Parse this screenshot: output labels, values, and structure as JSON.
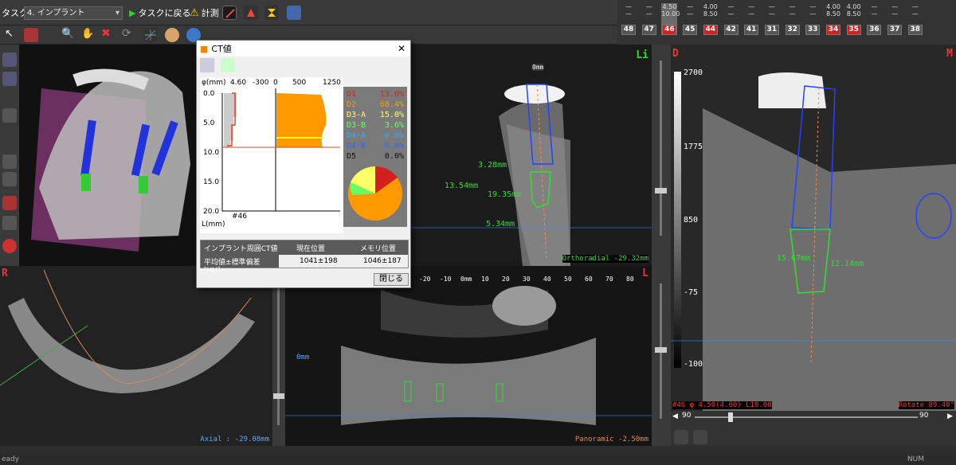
{
  "toolbar": {
    "task_label": "タスク",
    "task_value": "4. インプラント",
    "back_label": "タスクに戻る",
    "measure_label": "計測"
  },
  "teeth": {
    "upper": [
      {
        "l1": "",
        "l2": "",
        "num": "48"
      },
      {
        "l1": "",
        "l2": "",
        "num": "47"
      },
      {
        "l1": "4.50",
        "l2": "10.00",
        "num": "46",
        "sel": true
      },
      {
        "l1": "",
        "l2": "",
        "num": "45"
      },
      {
        "l1": "4.00",
        "l2": "8.50",
        "num": "44",
        "red": true
      },
      {
        "l1": "",
        "l2": "",
        "num": "42"
      },
      {
        "l1": "",
        "l2": "",
        "num": "41"
      },
      {
        "l1": "",
        "l2": "",
        "num": "31"
      },
      {
        "l1": "",
        "l2": "",
        "num": "32"
      },
      {
        "l1": "",
        "l2": "",
        "num": "33"
      },
      {
        "l1": "4.00",
        "l2": "8.50",
        "num": "34",
        "red": true
      },
      {
        "l1": "4.00",
        "l2": "8.50",
        "num": "35",
        "red": true
      },
      {
        "l1": "",
        "l2": "",
        "num": "36"
      },
      {
        "l1": "",
        "l2": "",
        "num": "37"
      },
      {
        "l1": "",
        "l2": "",
        "num": "38"
      }
    ]
  },
  "dialog": {
    "title": "CT値",
    "axis_phi": "φ(mm)",
    "phi_value": "4.60",
    "scale_neg": "-300",
    "scale_0": "0",
    "scale_500": "500",
    "scale_1250": "1250",
    "depth_ticks": [
      "0.0",
      "5.0",
      "10.0",
      "15.0",
      "20.0"
    ],
    "depth_unit": "L(mm)",
    "tooth_label": "#46",
    "density": [
      {
        "label": "D1",
        "value": "13.0%",
        "color": "#d42020"
      },
      {
        "label": "D2",
        "value": "68.4%",
        "color": "#ff9900"
      },
      {
        "label": "D3-A",
        "value": "15.0%",
        "color": "#ffff66"
      },
      {
        "label": "D3-B",
        "value": "3.6%",
        "color": "#66ff66"
      },
      {
        "label": "D4-A",
        "value": "0.0%",
        "color": "#33aaff"
      },
      {
        "label": "D4-B",
        "value": "0.0%",
        "color": "#3366ff"
      },
      {
        "label": "D5",
        "value": "0.0%",
        "color": "#111"
      }
    ],
    "table_head": [
      "インプラント周囲CT値",
      "現在位置",
      "メモリ位置"
    ],
    "row_label": "平均値±標準偏差[HU]",
    "current": "1041±198",
    "memory": "1046±187",
    "close_label": "閉じる"
  },
  "viewports": {
    "ortho_label": "Orthoradial -29.32mm",
    "axial_label": "Axial : -29.08mm",
    "pano_label": "Panoramic -2.50mm",
    "rot_left": "#46  φ 4.50(4.60)  L10.00",
    "rot_right": "Rotate 89.40°",
    "zero_mm": "0mm",
    "meas1": "3.28mm",
    "meas2": "13.54mm",
    "meas3": "19.35mm",
    "meas4": "5.34mm",
    "meas5": "15.67mm",
    "meas6": "12.14mm",
    "ruler": [
      "-20",
      "-10",
      "0mm",
      "10",
      "20",
      "30",
      "40",
      "50",
      "60",
      "70",
      "80"
    ],
    "corner_li": "Li",
    "corner_d": "D",
    "corner_m": "M",
    "corner_r": "R",
    "corner_l": "L",
    "hu_scale": [
      "2700",
      "1775",
      "850",
      "-75",
      "-1000"
    ],
    "slider_left": "90",
    "slider_right": "90"
  },
  "status": {
    "left": "eady",
    "right": "NUM"
  }
}
